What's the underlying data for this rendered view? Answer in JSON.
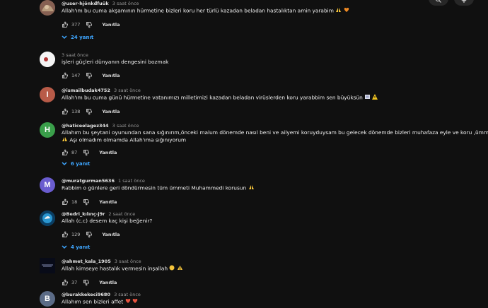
{
  "header": {
    "search_icon": "search-icon",
    "mic_icon": "mic-icon"
  },
  "comments": [
    {
      "author": "@user-hjönkđfuük",
      "time": "3 saat önce",
      "text": "Allah'ım bu cuma akşamının hürmetine bizleri koru her türlü kazadan beladan hastalıktan amin yarabim",
      "likes": "377",
      "reply_label": "Yanıtla",
      "replies_label": "24 yanıt",
      "avatar_color": "#8f6a58"
    },
    {
      "author": "",
      "time": "3 saat önce",
      "text": "işleri güçleri dünyanın dengesini bozmak",
      "likes": "147",
      "reply_label": "Yanıtla",
      "avatar_color": "#f1f1f1"
    },
    {
      "author": "@ismailbudak4752",
      "time": "3 saat önce",
      "text": "Allah'ım bu cuma günü hürmetine vatanımızı milletimizi kazadan beladan virüslerden koru yarabbim sen büyüksün",
      "likes": "138",
      "reply_label": "Yanıtla",
      "avatar_letter": "I",
      "avatar_color": "#b85b48"
    },
    {
      "author": "@haticeelagez344",
      "time": "3 saat önce",
      "text_line_1": "Allahım bu şeytani oyunundan sana sığınırım,önceki malum dönemde nasıl beni ve ailyemi koruyduysam bu gelecek dönemde bizleri muhafaza eyle ve koru ,ümmeti Muhammedi koru Allahım",
      "text_line_2": "Aşı olmadım olmamda Allah'ıma sığınıyorum",
      "likes": "87",
      "reply_label": "Yanıtla",
      "replies_label": "6 yanıt",
      "avatar_letter": "H",
      "avatar_color": "#3a9f4a"
    },
    {
      "author": "@muratgurman5636",
      "time": "1 saat önce",
      "text": "Rabbim o günlere geri döndürmesin tüm ümmeti Muhammedi korusun",
      "likes": "18",
      "reply_label": "Yanıtla",
      "avatar_letter": "M",
      "avatar_color": "#6a5ccf"
    },
    {
      "author": "@Bedri_kılınç-j9r",
      "time": "2 saat önce",
      "text": "Allah (c.c) desem kaç kişi beğenir?",
      "likes": "129",
      "reply_label": "Yanıtla",
      "replies_label": "4 yanıt",
      "avatar_color": "#0c5d8d"
    },
    {
      "author": "@ahmet_kala_1905",
      "time": "3 saat önce",
      "text": "Allah kimseye hastalık vermesin inşallah",
      "likes": "37",
      "reply_label": "Yanıtla",
      "avatar_color": "#0b1022"
    },
    {
      "author": "@burakkekeci9680",
      "time": "3 saat önce",
      "text": "Allahım sen bizleri affet",
      "avatar_letter": "B",
      "avatar_color": "#5b6b86"
    }
  ],
  "colors": {
    "background": "#101010",
    "primary_text": "#f1f1f1",
    "secondary_text": "#aaaaaa",
    "reply_link": "#3ea6ff"
  }
}
